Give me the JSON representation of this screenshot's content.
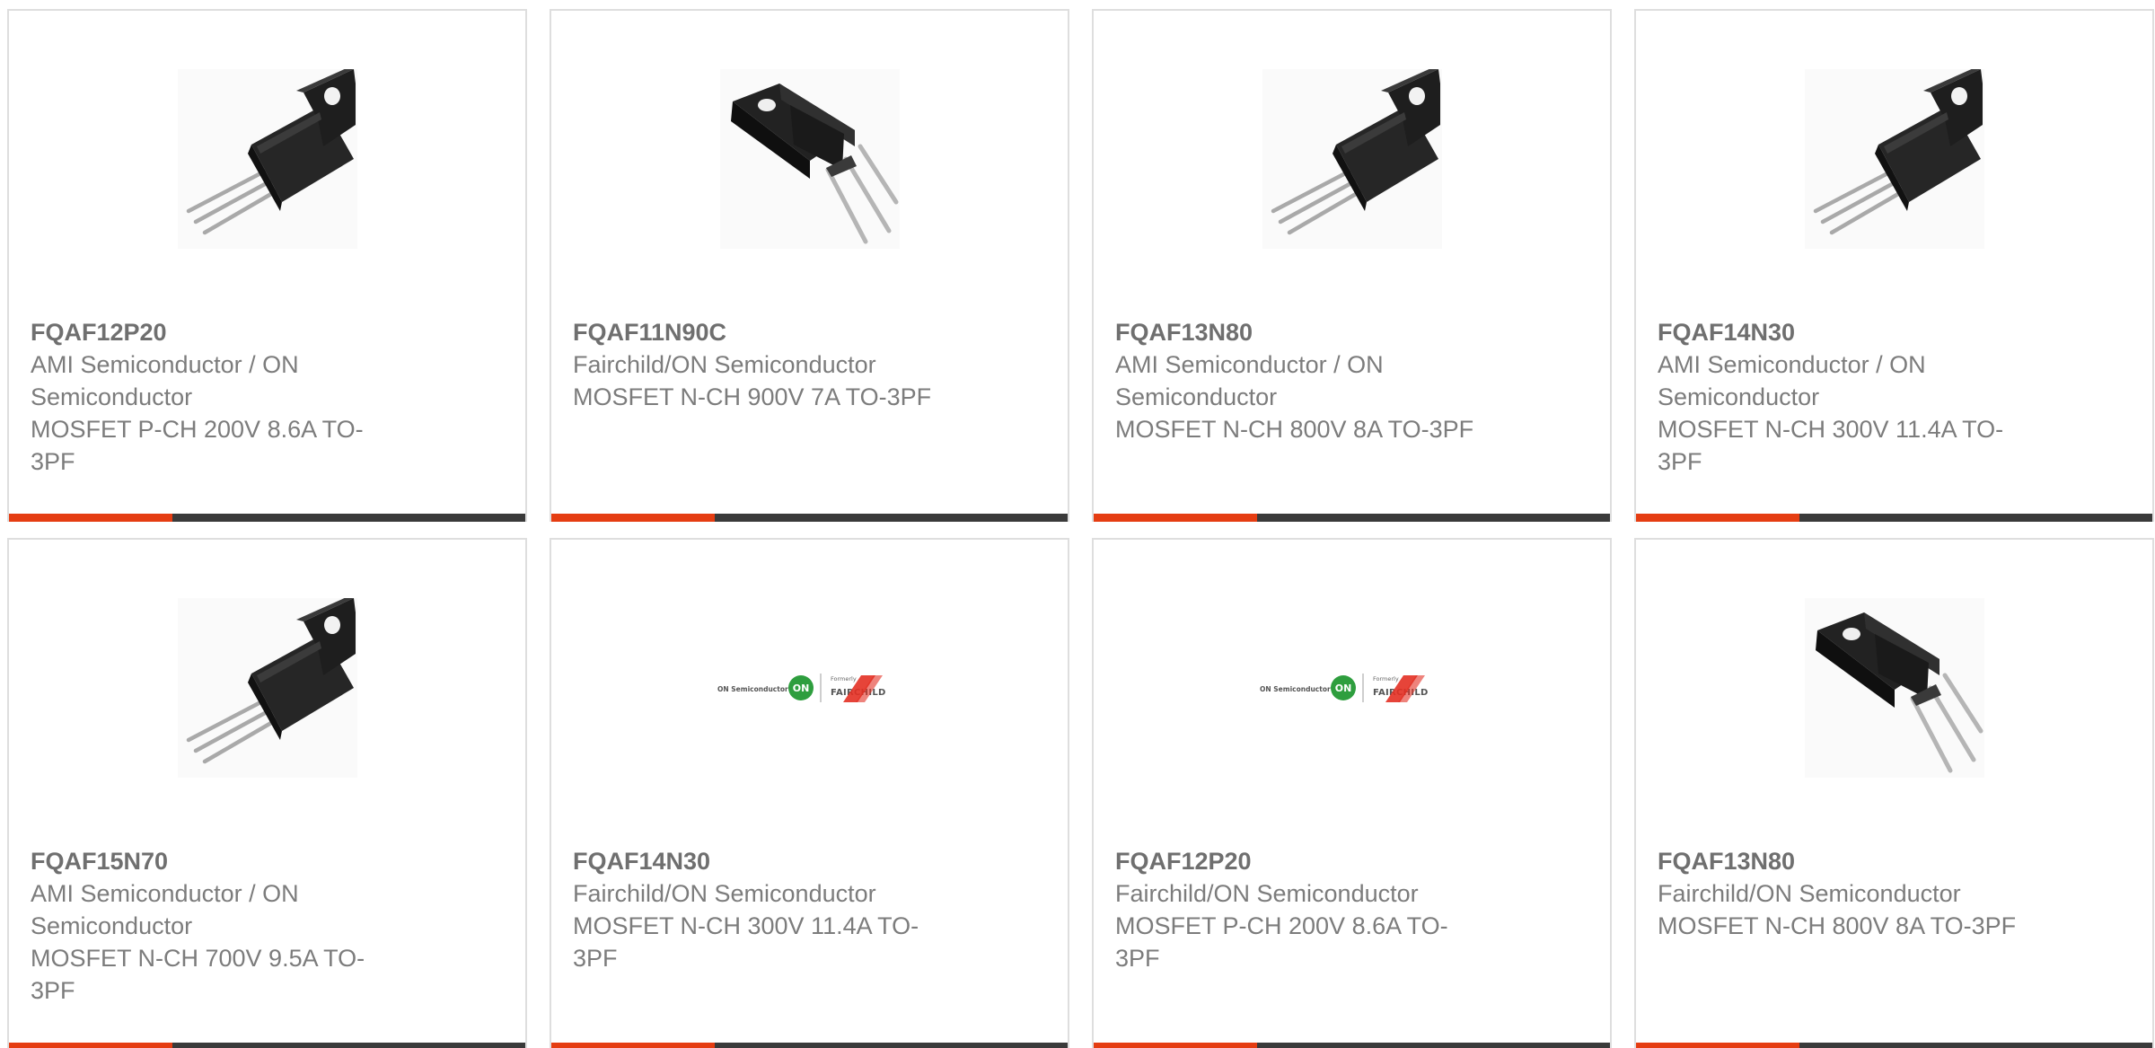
{
  "colors": {
    "accent": "#e53d12",
    "bar": "#3a3a3a",
    "border": "#dedede",
    "text": "#7c7c7c"
  },
  "products": [
    {
      "part_number": "FQAF12P20",
      "manufacturer": "AMI Semiconductor / ON Semiconductor",
      "description": "MOSFET P-CH 200V 8.6A TO-3PF",
      "image": "to-3pf-small"
    },
    {
      "part_number": "FQAF11N90C",
      "manufacturer": "Fairchild/ON Semiconductor",
      "description": "MOSFET N-CH 900V 7A TO-3PF",
      "image": "to-3pf-large"
    },
    {
      "part_number": "FQAF13N80",
      "manufacturer": "AMI Semiconductor / ON Semiconductor",
      "description": "MOSFET N-CH 800V 8A TO-3PF",
      "image": "to-3pf-small"
    },
    {
      "part_number": "FQAF14N30",
      "manufacturer": "AMI Semiconductor / ON Semiconductor",
      "description": "MOSFET N-CH 300V 11.4A TO-3PF",
      "image": "to-3pf-small"
    },
    {
      "part_number": "FQAF15N70",
      "manufacturer": "AMI Semiconductor / ON Semiconductor",
      "description": "MOSFET N-CH 700V 9.5A TO-3PF",
      "image": "to-3pf-small"
    },
    {
      "part_number": "FQAF14N30",
      "manufacturer": "Fairchild/ON Semiconductor",
      "description": "MOSFET N-CH 300V 11.4A TO-3PF",
      "image": "on-fairchild-logo"
    },
    {
      "part_number": "FQAF12P20",
      "manufacturer": "Fairchild/ON Semiconductor",
      "description": "MOSFET P-CH 200V 8.6A TO-3PF",
      "image": "on-fairchild-logo"
    },
    {
      "part_number": "FQAF13N80",
      "manufacturer": "Fairchild/ON Semiconductor",
      "description": "MOSFET N-CH 800V 8A TO-3PF",
      "image": "to-3pf-large"
    }
  ],
  "logo_text": {
    "on_semi": "ON Semiconductor",
    "on": "ON",
    "formerly": "Formerly",
    "fairchild": "FAIRCHILD"
  }
}
